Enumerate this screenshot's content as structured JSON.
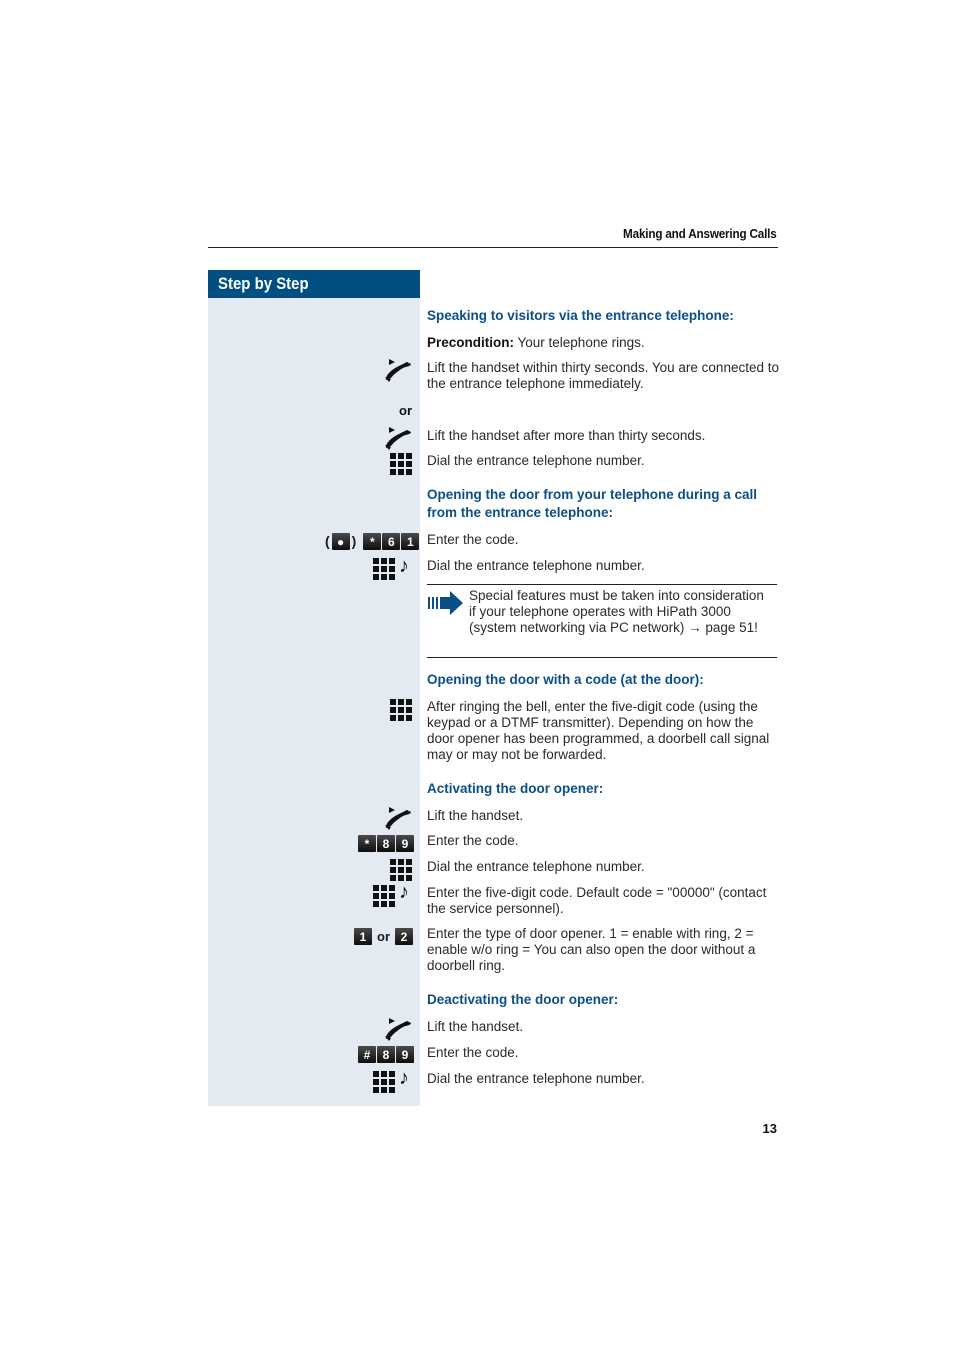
{
  "header": {
    "title": "Making and Answering Calls"
  },
  "sidebar": {
    "title": "Step by Step"
  },
  "sections": [
    {
      "heading": "Speaking to visitors via the entrance telephone:",
      "precondition_label": "Precondition:",
      "precondition_text": " Your telephone rings.",
      "steps": [
        {
          "icon": "handset-lift-icon",
          "text": "Lift the handset within thirty seconds. You are connected to the entrance telephone immediately."
        },
        {
          "label": "or"
        },
        {
          "icon": "handset-lift-icon",
          "text": "Lift the handset after more than thirty seconds."
        },
        {
          "icon": "keypad-icon",
          "text": "Dial the entrance telephone number."
        }
      ]
    },
    {
      "heading": "Opening the door from your telephone during a call from the entrance telephone:",
      "steps": [
        {
          "keys": [
            "*",
            "6",
            "1"
          ],
          "prefix_key": "●",
          "text": "Enter the code."
        },
        {
          "icon": "keypad-tone-icon",
          "text": "Dial the entrance telephone number."
        }
      ],
      "note": "Special features must be taken into consideration if your telephone operates with HiPath 3000 (system networking via PC network) → page 51!"
    },
    {
      "heading": "Opening the door with a code (at the door):",
      "steps": [
        {
          "icon": "keypad-icon",
          "text": "After ringing the bell, enter the five-digit code (using the keypad or a DTMF transmitter). Depending on how the door opener has been programmed, a doorbell call signal may or may not be forwarded."
        }
      ]
    },
    {
      "heading": "Activating the door opener:",
      "steps": [
        {
          "icon": "handset-lift-icon",
          "text": "Lift the handset."
        },
        {
          "keys": [
            "*",
            "8",
            "9"
          ],
          "text": "Enter the code."
        },
        {
          "icon": "keypad-icon",
          "text": "Dial the entrance telephone number."
        },
        {
          "icon": "keypad-tone-icon",
          "text": "Enter the five-digit code. Default code = \"00000\" (contact the service personnel)."
        },
        {
          "keys_alt": [
            "1",
            "2"
          ],
          "or_label": "or",
          "text": "Enter the type of door opener. 1 = enable with ring, 2 = enable w/o ring = You can also open the door without a doorbell ring."
        }
      ]
    },
    {
      "heading": "Deactivating the door opener:",
      "steps": [
        {
          "icon": "handset-lift-icon",
          "text": "Lift the handset."
        },
        {
          "keys": [
            "#",
            "8",
            "9"
          ],
          "text": "Enter the code."
        },
        {
          "icon": "keypad-tone-icon",
          "text": "Dial the entrance telephone number."
        }
      ]
    }
  ],
  "footer": {
    "page_number": "13"
  },
  "colors": {
    "accent": "#004f80",
    "heading": "#0c4f87",
    "sidebar_bg": "#e3eaf2"
  }
}
